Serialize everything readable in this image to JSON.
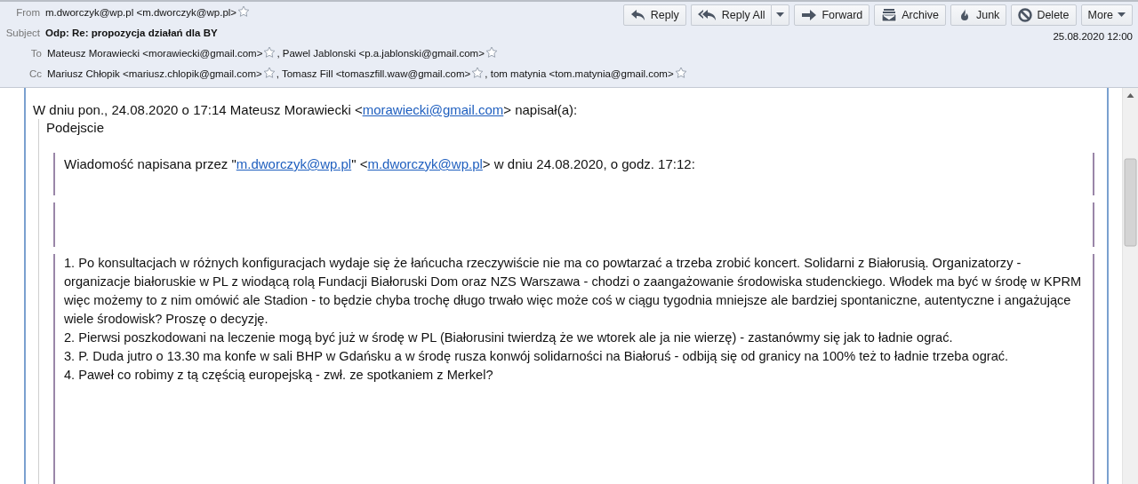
{
  "header": {
    "fields": [
      {
        "label": "From",
        "kind": "addresses",
        "entries": [
          {
            "text": "m.dworczyk@wp.pl <m.dworczyk@wp.pl>",
            "starred": false
          }
        ]
      },
      {
        "label": "Subject",
        "kind": "subject",
        "text": "Odp: Re: propozycja działań dla BY",
        "date": "25.08.2020 12:00"
      },
      {
        "label": "To",
        "kind": "addresses",
        "entries": [
          {
            "text": "Mateusz Morawiecki <morawiecki@gmail.com>",
            "starred": false
          },
          {
            "text": ", Pawel Jablonski <p.a.jablonski@gmail.com>",
            "starred": false
          }
        ]
      },
      {
        "label": "Cc",
        "kind": "addresses",
        "entries": [
          {
            "text": "Mariusz Chłopik <mariusz.chlopik@gmail.com>",
            "starred": false
          },
          {
            "text": ", Tomasz Fill <tomaszfill.waw@gmail.com>",
            "starred": false
          },
          {
            "text": ", tom matynia <tom.matynia@gmail.com>",
            "starred": false
          }
        ]
      }
    ],
    "buttons": [
      {
        "label": "Reply",
        "kind": "reply"
      },
      {
        "label": "Reply All",
        "kind": "replyall"
      },
      {
        "label": "Forward",
        "kind": "forward"
      },
      {
        "label": "Archive",
        "kind": "archive"
      },
      {
        "label": "Junk",
        "kind": "junk"
      },
      {
        "label": "Delete",
        "kind": "delete"
      },
      {
        "label": "More",
        "kind": "more"
      }
    ]
  },
  "body": {
    "attribution": [
      {
        "kind": "text",
        "text": "W dniu pon., 24.08.2020 o 17:14 Mateusz Morawiecki <"
      },
      {
        "kind": "link",
        "text": "morawiecki@gmail.com"
      },
      {
        "kind": "text",
        "text": "> napisał(a):"
      }
    ],
    "reply_text": "Podejscie",
    "quotes": [
      {
        "kind": "segments",
        "segments": [
          {
            "kind": "text",
            "text": "Wiadomość napisana przez \""
          },
          {
            "kind": "link",
            "text": "m.dworczyk@wp.pl"
          },
          {
            "kind": "text",
            "text": "\" <"
          },
          {
            "kind": "link",
            "text": "m.dworczyk@wp.pl"
          },
          {
            "kind": "text",
            "text": "> w dniu 24.08.2020, o godz. 17:12:"
          }
        ]
      },
      {
        "kind": "empty"
      },
      {
        "kind": "paragraphs",
        "paragraphs": [
          "1. Po konsultacjach w różnych konfiguracjach wydaje się że łańcucha rzeczywiście nie ma co powtarzać a trzeba zrobić koncert. Solidarni z Białorusią. Organizatorzy - organizacje białoruskie w PL z wiodącą rolą Fundacji Białoruski Dom oraz NZS Warszawa - chodzi o zaangażowanie środowiska studenckiego. Włodek ma być w środę w KPRM więc możemy to z nim omówić ale Stadion - to będzie chyba trochę długo trwało więc może coś w ciągu tygodnia mniejsze ale bardziej spontaniczne, autentyczne i angażujące wiele środowisk? Proszę o decyzję.",
          "2. Pierwsi poszkodowani na leczenie mogą być już w środę w PL (Białorusini twierdzą że we wtorek ale ja nie wierzę) - zastanówmy się jak to ładnie ograć.",
          "3. P. Duda jutro o 13.30 ma konfe w sali BHP w Gdańsku a w środę rusza konwój solidarności na Białoruś - odbiją się od granicy na 100% też to ładnie trzeba ograć.",
          "4. Paweł co robimy z tą częścią europejską - zwł. ze spotkaniem z Merkel?"
        ]
      }
    ]
  }
}
